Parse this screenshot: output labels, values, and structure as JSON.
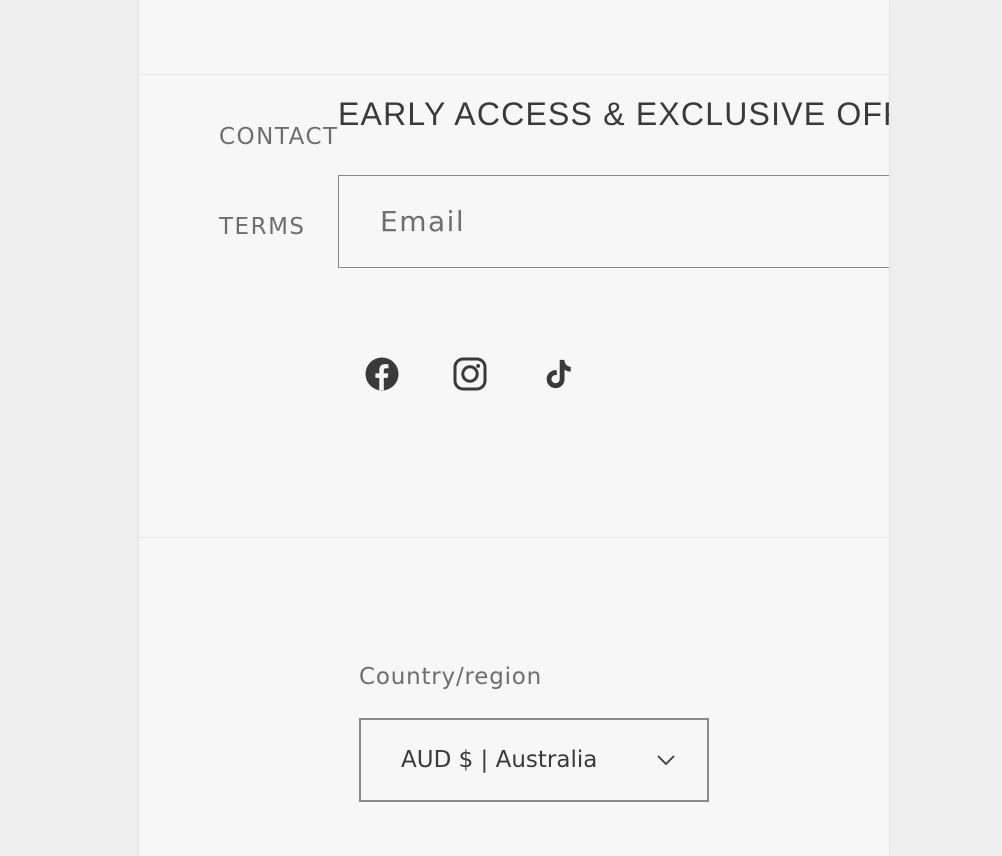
{
  "footer": {
    "links": [
      {
        "label": "CONTACT"
      },
      {
        "label": "TERMS"
      }
    ]
  },
  "newsletter": {
    "heading": "EARLY ACCESS & EXCLUSIVE OFFERS",
    "email_placeholder": "Email"
  },
  "social": [
    {
      "icon": "facebook-icon"
    },
    {
      "icon": "instagram-icon"
    },
    {
      "icon": "tiktok-icon"
    }
  ],
  "localization": {
    "label": "Country/region",
    "selected": "AUD $ | Australia"
  },
  "colors": {
    "page_background": "#f7f7f7",
    "outer_background": "#efefef",
    "text_dark": "#3a3a3a",
    "text_muted": "#6e6e6e",
    "border": "#8a8a8a"
  }
}
